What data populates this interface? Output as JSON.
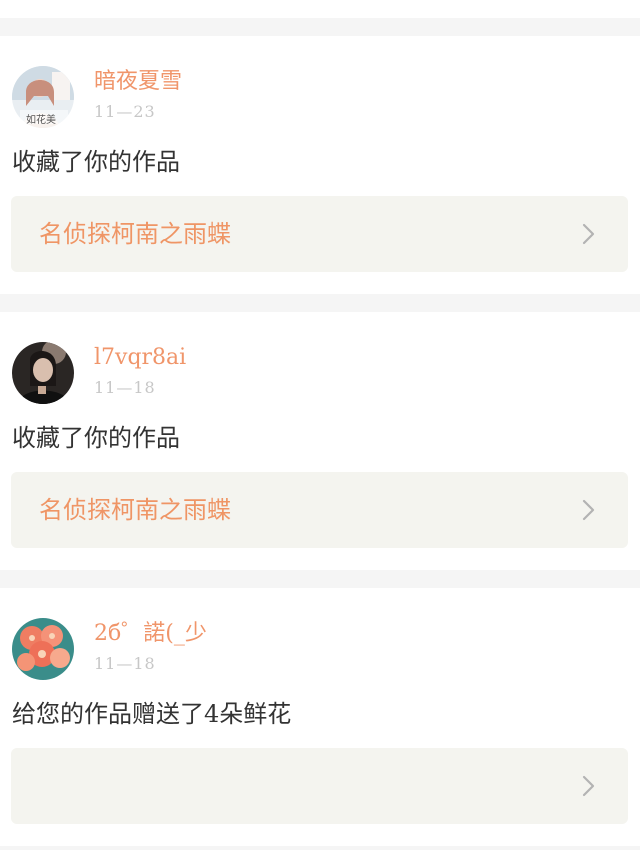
{
  "feed": {
    "items": [
      {
        "username": "暗夜夏雪",
        "date": "11—23",
        "avatar_caption": "如花美",
        "action": "收藏了你的作品",
        "work_title": "名侦探柯南之雨蝶"
      },
      {
        "username": "l7vqr8ai",
        "date": "11—18",
        "action": "收藏了你的作品",
        "work_title": "名侦探柯南之雨蝶"
      },
      {
        "username": "2б゜諾(_少",
        "date": "11—18",
        "action": "给您的作品赠送了4朵鲜花",
        "work_title": ""
      }
    ]
  },
  "colors": {
    "username": "#f0956a",
    "work_title": "#ef9565",
    "date": "#c7c7c7",
    "card_bg": "#ffffff",
    "page_bg": "#f5f5f5",
    "link_bg": "#f4f4ef"
  },
  "icons": [
    "chevron-right-icon"
  ]
}
